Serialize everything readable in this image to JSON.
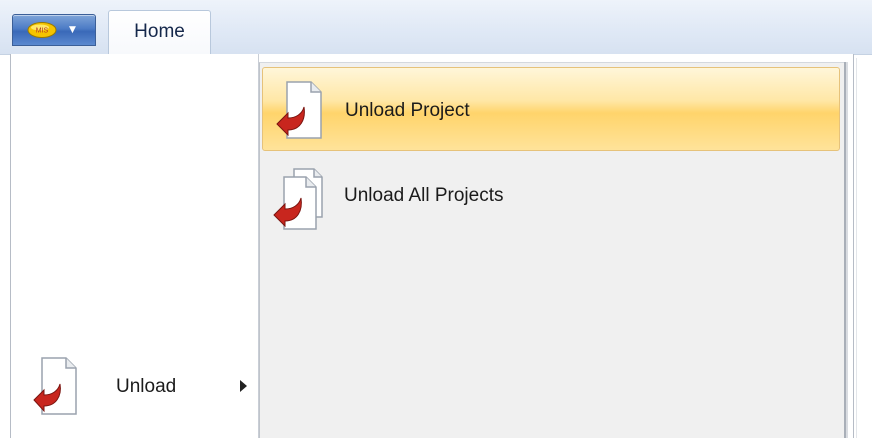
{
  "ribbon": {
    "app_button_icon": "app-logo-icon",
    "tabs": [
      {
        "label": "Home"
      }
    ]
  },
  "menu": {
    "left_items": [
      {
        "label": "Unload",
        "icon": "unload-document-icon",
        "has_submenu": true
      }
    ],
    "submenu_items": [
      {
        "label": "Unload Project",
        "icon": "unload-document-icon",
        "highlighted": true
      },
      {
        "label": "Unload All Projects",
        "icon": "unload-documents-icon",
        "highlighted": false
      }
    ]
  },
  "colors": {
    "ribbon_bg": "#e0e9f6",
    "app_button": "#4d7cc6",
    "highlight": "#ffd46b",
    "submenu_bg": "#f0f0f0",
    "arrow_red": "#c8261e"
  }
}
